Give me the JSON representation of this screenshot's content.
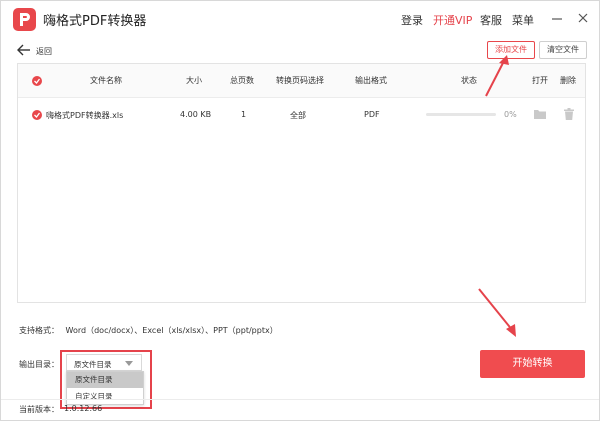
{
  "app": {
    "title": "嗨格式PDF转换器",
    "brand_color": "#e8474b"
  },
  "titlebar": {
    "menu": [
      "登录",
      "开通VIP",
      "客服",
      "菜单"
    ],
    "window_controls": [
      "minimize-icon",
      "close-icon"
    ]
  },
  "toolbar": {
    "back_label": "返回",
    "add_file_label": "添加文件",
    "clear_file_label": "清空文件"
  },
  "table": {
    "columns": [
      "文件名称",
      "大小",
      "总页数",
      "转换页码选择",
      "输出格式",
      "状态",
      "打开",
      "删除"
    ],
    "rows": [
      {
        "name": "嗨格式PDF转换器.xls",
        "size": "4.00 KB",
        "pages": "1",
        "page_select": "全部",
        "format": "PDF",
        "progress": 0,
        "progress_label": "0%",
        "open_icon": "folder-icon",
        "delete_icon": "trash-icon"
      }
    ]
  },
  "formats": {
    "label": "支持格式：",
    "value": "Word（doc/docx）、Excel（xls/xlsx）、PPT（ppt/pptx）"
  },
  "output": {
    "label": "输出目录：",
    "selected": "原文件目录",
    "options": [
      "原文件目录",
      "自定义目录"
    ]
  },
  "start_label": "开始转换",
  "version": {
    "label": "当前版本：",
    "value": "1.0.12.66"
  }
}
